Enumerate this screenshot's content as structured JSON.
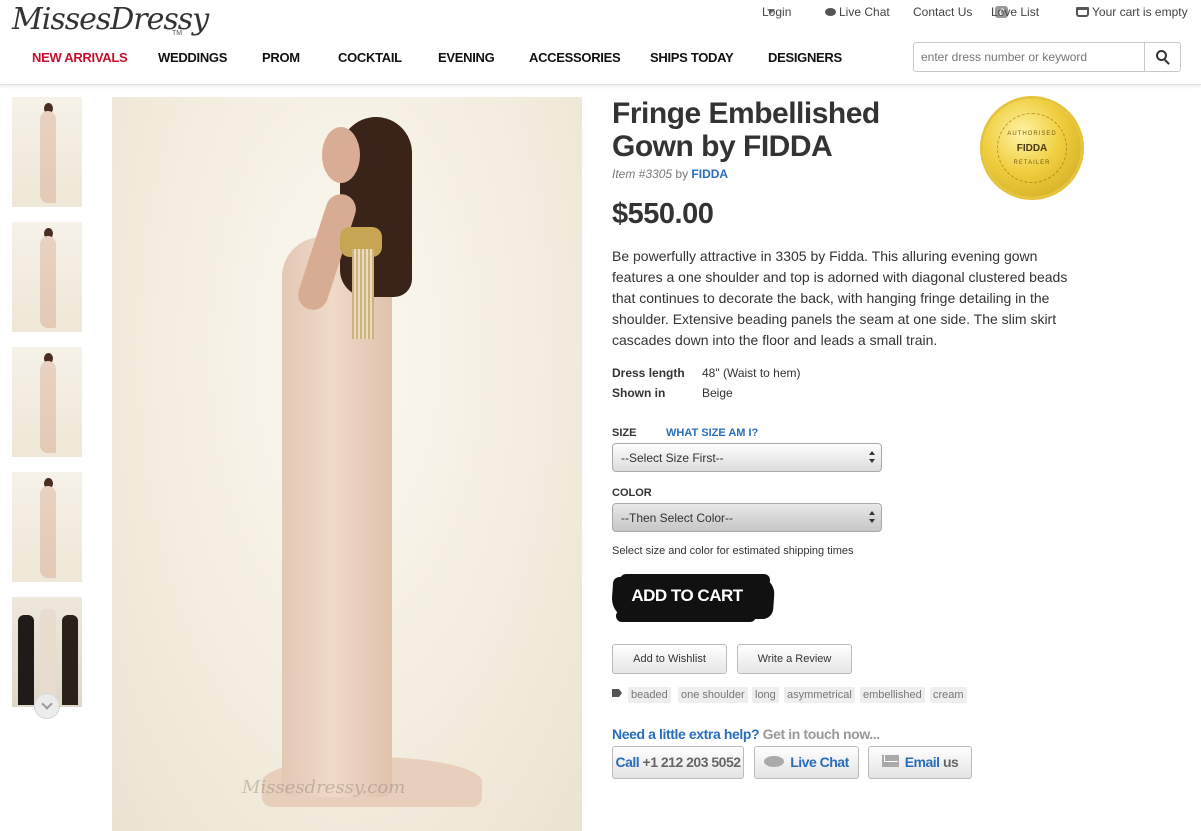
{
  "brand": {
    "logo_text": "MissesDressy",
    "tm": "TM"
  },
  "utility": {
    "login": "Login",
    "live_chat": "Live Chat",
    "contact": "Contact Us",
    "love_list": "Love List",
    "love_count": "0",
    "cart": "Your cart is empty"
  },
  "nav": [
    "NEW ARRIVALS",
    "WEDDINGS",
    "PROM",
    "COCKTAIL",
    "EVENING",
    "ACCESSORIES",
    "SHIPS TODAY",
    "DESIGNERS"
  ],
  "search": {
    "placeholder": "enter dress number or keyword"
  },
  "photo": {
    "watermark": "Missesdressy.com"
  },
  "product": {
    "title": "Fringe Embellished Gown by FIDDA",
    "item_label": "Item #3305",
    "by": "by",
    "designer": "FIDDA",
    "price": "$550.00",
    "description": "Be powerfully attractive in 3305 by Fidda. This alluring evening gown features a one shoulder and top is adorned with diagonal clustered beads that continues to decorate the back, with hanging fringe detailing in the shoulder. Extensive beading panels the seam at one side. The slim skirt cascades down into the floor and leads a small train.",
    "specs": [
      {
        "label": "Dress length",
        "value": "48\" (Waist to hem)"
      },
      {
        "label": "Shown in",
        "value": "Beige"
      }
    ]
  },
  "seal": {
    "top_text": "AUTHORISED",
    "brand": "FIDDA",
    "bottom_text": "RETAILER"
  },
  "options": {
    "size_label": "SIZE",
    "size_help": "WHAT SIZE AM I?",
    "size_placeholder": "--Select Size First--",
    "color_label": "COLOR",
    "color_placeholder": "--Then Select Color--",
    "ship_note": "Select size and color for estimated shipping times"
  },
  "actions": {
    "add_to_cart": "ADD TO CART",
    "wishlist": "Add to Wishlist",
    "review": "Write a Review"
  },
  "tags": [
    "beaded",
    "one shoulder",
    "long",
    "asymmetrical",
    "embellished",
    "cream"
  ],
  "help": {
    "question": "Need a little extra help?",
    "prompt": "Get in touch now...",
    "call_label": "Call",
    "call_number": "+1 212 203 5052",
    "chat_label": "Live Chat",
    "email_label": "Email",
    "email_suffix": "us"
  },
  "colors": {
    "accent_red": "#c8102e",
    "link_blue": "#2a6ebb",
    "seal_gold": "#efce3e"
  }
}
